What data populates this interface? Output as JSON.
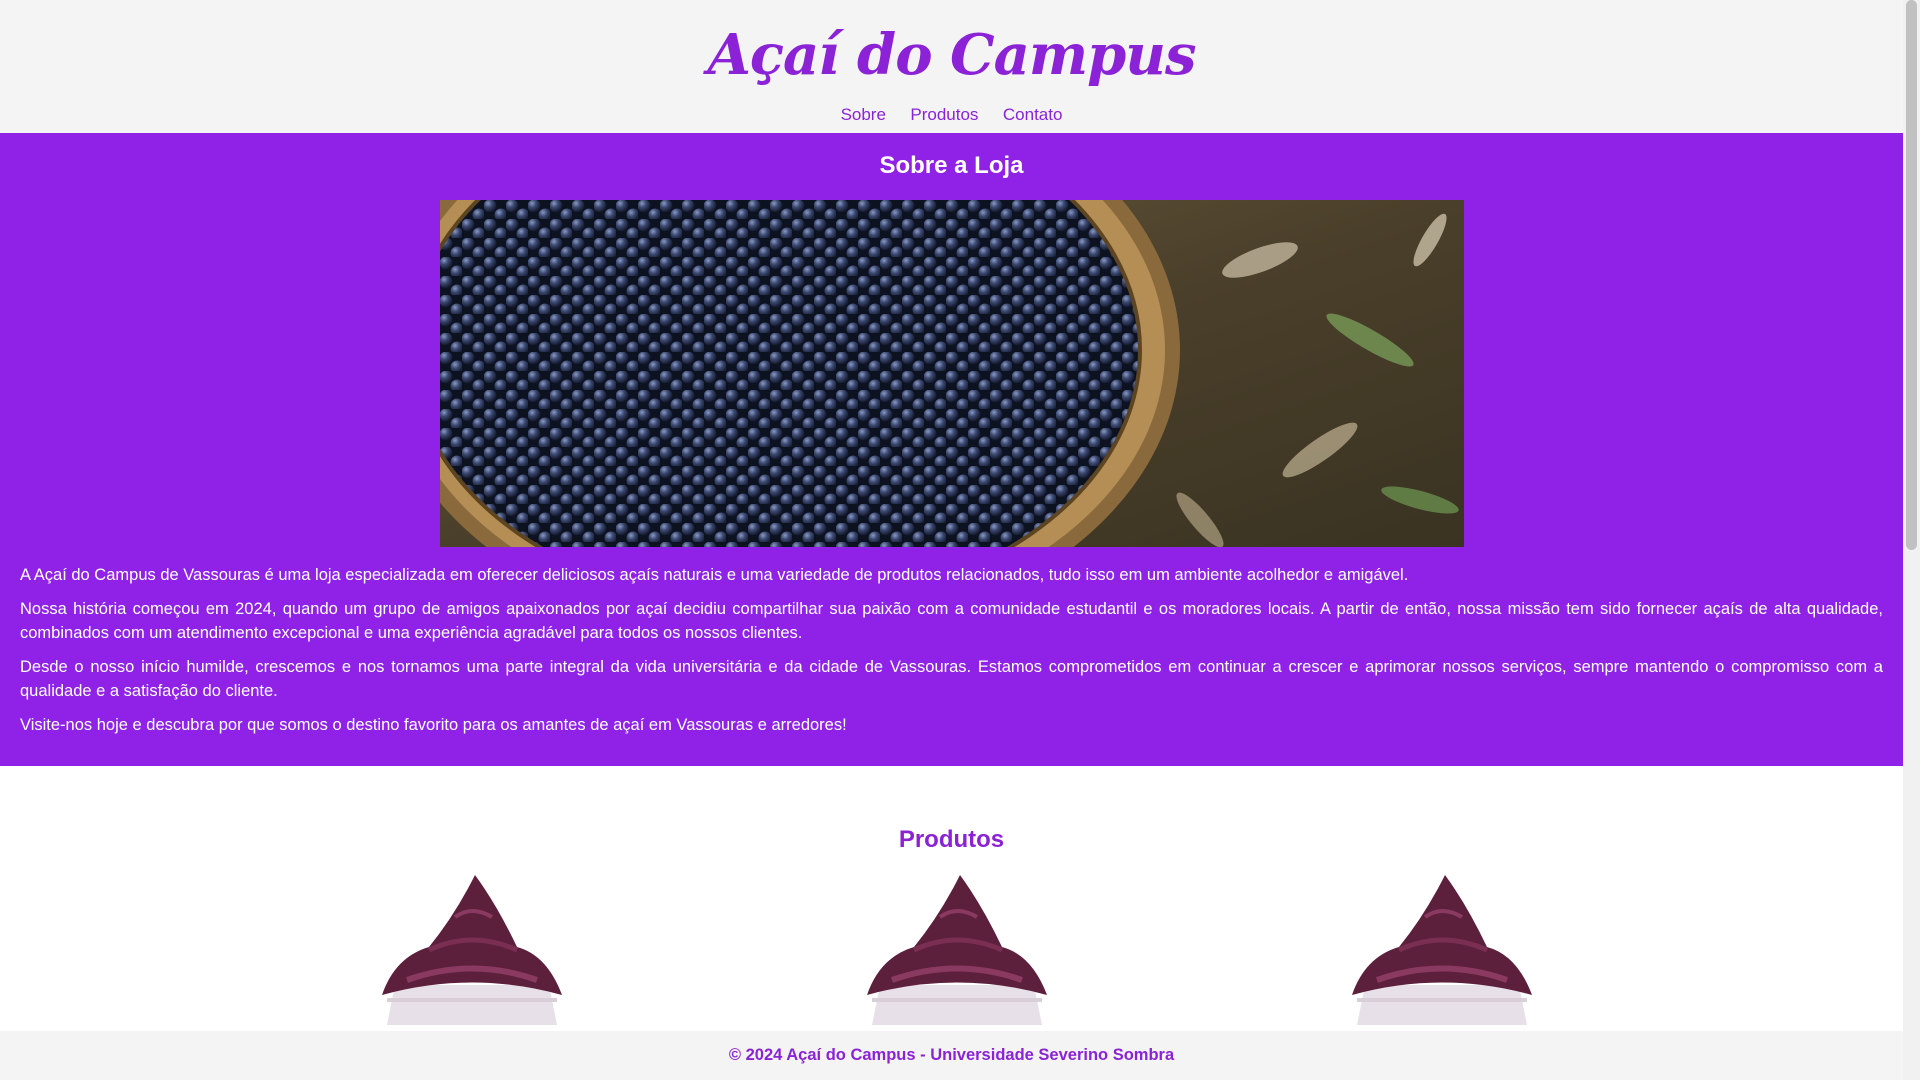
{
  "header": {
    "logo": "Açaí do Campus",
    "nav": [
      "Sobre",
      "Produtos",
      "Contato"
    ]
  },
  "about": {
    "title": "Sobre a Loja",
    "paragraphs": [
      "A Açaí do Campus de Vassouras é uma loja especializada em oferecer deliciosos açaís naturais e uma variedade de produtos relacionados, tudo isso em um ambiente acolhedor e amigável.",
      "Nossa história começou em 2024, quando um grupo de amigos apaixonados por açaí decidiu compartilhar sua paixão com a comunidade estudantil e os moradores locais. A partir de então, nossa missão tem sido fornecer açaís de alta qualidade, combinados com um atendimento excepcional e uma experiência agradável para todos os nossos clientes.",
      "Desde o nosso início humilde, crescemos e nos tornamos uma parte integral da vida universitária e da cidade de Vassouras. Estamos comprometidos em continuar a crescer e aprimorar nossos serviços, sempre mantendo o compromisso com a qualidade e a satisfação do cliente.",
      "Visite-nos hoje e descubra por que somos o destino favorito para os amantes de açaí em Vassouras e arredores!"
    ]
  },
  "products": {
    "title": "Produtos"
  },
  "footer": {
    "text": "© 2024 Açaí do Campus - Universidade Severino Sombra"
  },
  "colors": {
    "brand_purple": "#8f22e6",
    "light_gray": "#f4f4f4"
  },
  "icons": [
    "acai-basket-image",
    "acai-cup-image"
  ]
}
